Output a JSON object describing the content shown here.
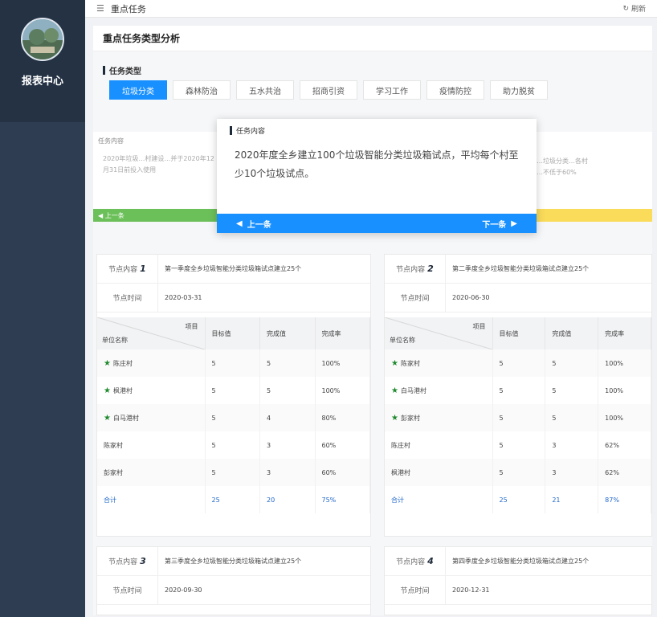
{
  "sidebar": {
    "title": "报表中心"
  },
  "topbar": {
    "title": "重点任务",
    "refresh": "刷新"
  },
  "panel": {
    "title": "重点任务类型分析",
    "type_label": "任务类型",
    "tabs": [
      {
        "label": "垃圾分类",
        "active": true
      },
      {
        "label": "森林防治",
        "active": false
      },
      {
        "label": "五水共治",
        "active": false
      },
      {
        "label": "招商引资",
        "active": false
      },
      {
        "label": "学习工作",
        "active": false
      },
      {
        "label": "疫情防控",
        "active": false
      },
      {
        "label": "助力脱贫",
        "active": false
      }
    ]
  },
  "bg_cards": {
    "left_label": "任务内容",
    "left_text": "2020年垃圾…村建设…并于2020年12月31日前投入使用",
    "left_nav": "上一条",
    "right_text": "…垃圾分类…各村",
    "right_text2": "…不低于60%"
  },
  "popup": {
    "label": "任务内容",
    "text": "2020年度全乡建立100个垃圾智能分类垃圾箱试点，平均每个村至少10个垃圾试点。",
    "prev": "上一条",
    "next": "下一条"
  },
  "nodes": [
    {
      "key": "节点内容",
      "num": "1",
      "content": "第一季度全乡垃圾智能分类垃圾箱试点建立25个",
      "date_key": "节点时间",
      "date": "2020-03-31",
      "head_top": "项目",
      "head_bot": "单位名称",
      "cols": [
        "目标值",
        "完成值",
        "完成率"
      ],
      "rows": [
        {
          "name": "陈庄村",
          "star": true,
          "t": "5",
          "d": "5",
          "r": "100%"
        },
        {
          "name": "枫港村",
          "star": true,
          "t": "5",
          "d": "5",
          "r": "100%"
        },
        {
          "name": "白马港村",
          "star": true,
          "t": "5",
          "d": "4",
          "r": "80%"
        },
        {
          "name": "陈家村",
          "star": false,
          "t": "5",
          "d": "3",
          "r": "60%"
        },
        {
          "name": "彭家村",
          "star": false,
          "t": "5",
          "d": "3",
          "r": "60%"
        }
      ],
      "total": {
        "name": "合计",
        "t": "25",
        "d": "20",
        "r": "75%"
      }
    },
    {
      "key": "节点内容",
      "num": "2",
      "content": "第二季度全乡垃圾智能分类垃圾箱试点建立25个",
      "date_key": "节点时间",
      "date": "2020-06-30",
      "head_top": "项目",
      "head_bot": "单位名称",
      "cols": [
        "目标值",
        "完成值",
        "完成率"
      ],
      "rows": [
        {
          "name": "陈家村",
          "star": true,
          "t": "5",
          "d": "5",
          "r": "100%"
        },
        {
          "name": "白马港村",
          "star": true,
          "t": "5",
          "d": "5",
          "r": "100%"
        },
        {
          "name": "彭家村",
          "star": true,
          "t": "5",
          "d": "5",
          "r": "100%"
        },
        {
          "name": "陈庄村",
          "star": false,
          "t": "5",
          "d": "3",
          "r": "62%"
        },
        {
          "name": "枫港村",
          "star": false,
          "t": "5",
          "d": "3",
          "r": "62%"
        }
      ],
      "total": {
        "name": "合计",
        "t": "25",
        "d": "21",
        "r": "87%"
      }
    },
    {
      "key": "节点内容",
      "num": "3",
      "content": "第三季度全乡垃圾智能分类垃圾箱试点建立25个",
      "date_key": "节点时间",
      "date": "2020-09-30"
    },
    {
      "key": "节点内容",
      "num": "4",
      "content": "第四季度全乡垃圾智能分类垃圾箱试点建立25个",
      "date_key": "节点时间",
      "date": "2020-12-31"
    }
  ],
  "colors": {
    "accent": "#1890ff",
    "sidebar": "#2f3d52",
    "green_bar": "#6cc05a",
    "yellow_bar": "#fadb5a"
  },
  "icons": {
    "menu": "hamburger-icon",
    "refresh": "refresh-icon",
    "prev": "arrow-left-icon",
    "next": "arrow-right-icon",
    "star": "star-icon"
  }
}
